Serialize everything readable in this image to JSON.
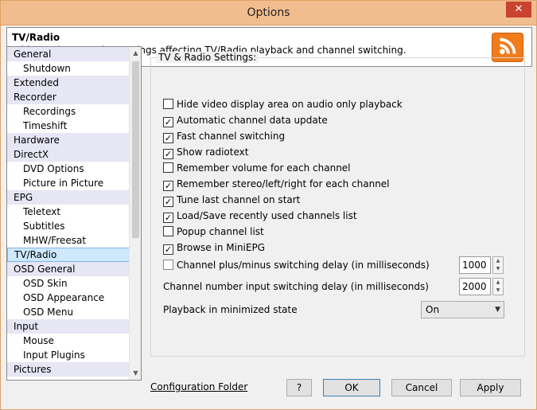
{
  "window": {
    "title": "Options",
    "close_symbol": "✕"
  },
  "header": {
    "title": "TV/Radio",
    "description": "This section contains settings affecting TV/Radio playback and channel switching."
  },
  "tree": {
    "items": [
      {
        "label": "General",
        "level": "top"
      },
      {
        "label": "Shutdown",
        "level": "sub"
      },
      {
        "label": "Extended",
        "level": "top"
      },
      {
        "label": "Recorder",
        "level": "top"
      },
      {
        "label": "Recordings",
        "level": "sub"
      },
      {
        "label": "Timeshift",
        "level": "sub"
      },
      {
        "label": "Hardware",
        "level": "top"
      },
      {
        "label": "DirectX",
        "level": "top"
      },
      {
        "label": "DVD Options",
        "level": "sub"
      },
      {
        "label": "Picture in Picture",
        "level": "sub"
      },
      {
        "label": "EPG",
        "level": "top"
      },
      {
        "label": "Teletext",
        "level": "sub"
      },
      {
        "label": "Subtitles",
        "level": "sub"
      },
      {
        "label": "MHW/Freesat",
        "level": "sub"
      },
      {
        "label": "TV/Radio",
        "level": "top",
        "selected": true
      },
      {
        "label": "OSD General",
        "level": "top"
      },
      {
        "label": "OSD Skin",
        "level": "sub"
      },
      {
        "label": "OSD Appearance",
        "level": "sub"
      },
      {
        "label": "OSD Menu",
        "level": "sub"
      },
      {
        "label": "Input",
        "level": "top"
      },
      {
        "label": "Mouse",
        "level": "sub"
      },
      {
        "label": "Input Plugins",
        "level": "sub"
      },
      {
        "label": "Pictures",
        "level": "top"
      }
    ]
  },
  "settings": {
    "group_label": "TV & Radio Settings:",
    "checkboxes": [
      {
        "label": "Hide video display area on audio only playback",
        "checked": false
      },
      {
        "label": "Automatic channel data update",
        "checked": true
      },
      {
        "label": "Fast channel switching",
        "checked": true
      },
      {
        "label": "Show radiotext",
        "checked": true
      },
      {
        "label": "Remember volume for each channel",
        "checked": false
      },
      {
        "label": "Remember stereo/left/right for each channel",
        "checked": true
      },
      {
        "label": "Tune last channel on start",
        "checked": true
      },
      {
        "label": "Load/Save recently used channels list",
        "checked": true
      },
      {
        "label": "Popup channel list",
        "checked": false
      },
      {
        "label": "Browse in MiniEPG",
        "checked": true
      },
      {
        "label": "Channel plus/minus switching delay (in milliseconds)",
        "checked": false,
        "disabled": true
      }
    ],
    "plus_minus_delay": "1000",
    "number_delay_label": "Channel number input switching delay (in milliseconds)",
    "number_delay": "2000",
    "minimized_label": "Playback in minimized state",
    "minimized_value": "On"
  },
  "footer": {
    "config_link": "Configuration Folder",
    "help_label": "?",
    "ok_label": "OK",
    "cancel_label": "Cancel",
    "apply_label": "Apply"
  },
  "colors": {
    "title_bar": "#f2bd8e",
    "close_button": "#c9432f",
    "rss_orange": "#f07c1c",
    "selection": "#cde8ff"
  },
  "icons": {
    "rss": "rss-feed-icon",
    "close": "close-icon",
    "scroll_up": "chevron-up-icon",
    "scroll_down": "chevron-down-icon"
  }
}
